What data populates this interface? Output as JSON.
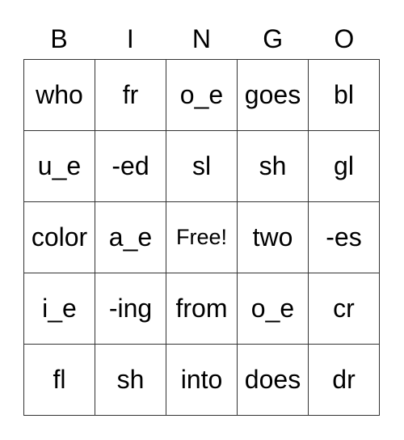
{
  "header": {
    "letters": [
      "B",
      "I",
      "N",
      "G",
      "O"
    ]
  },
  "board": {
    "rows": [
      [
        "who",
        "fr",
        "o_e",
        "goes",
        "bl"
      ],
      [
        "u_e",
        "-ed",
        "sl",
        "sh",
        "gl"
      ],
      [
        "color",
        "a_e",
        "Free!",
        "two",
        "-es"
      ],
      [
        "i_e",
        "-ing",
        "from",
        "o_e",
        "cr"
      ],
      [
        "fl",
        "sh",
        "into",
        "does",
        "dr"
      ]
    ]
  }
}
